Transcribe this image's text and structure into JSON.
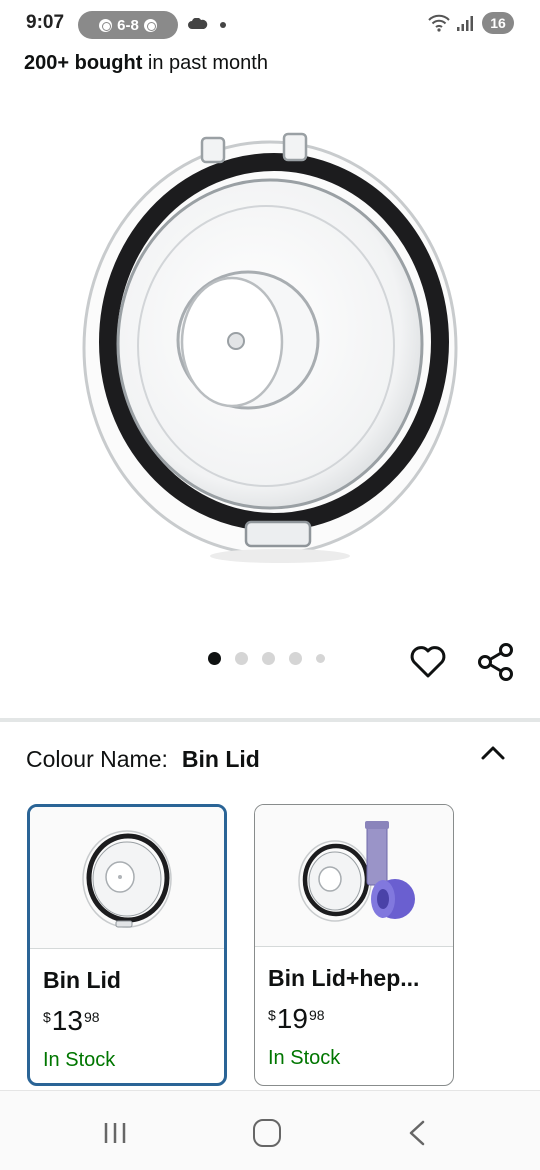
{
  "status_bar": {
    "time": "9:07",
    "score": "6-8",
    "battery": "16",
    "icons": [
      "cloud-icon",
      "wifi-icon",
      "signal-icon",
      "battery-icon"
    ]
  },
  "bought": {
    "count": "200+ bought",
    "suffix": " in past month"
  },
  "carousel": {
    "total_images": 5,
    "active_index": 0
  },
  "colour": {
    "label": "Colour Name:",
    "value": "Bin Lid"
  },
  "swatches": [
    {
      "title": "Bin Lid",
      "currency": "$",
      "whole": "13",
      "fraction": "98",
      "stock": "In Stock",
      "selected": true
    },
    {
      "title": "Bin Lid+hep...",
      "currency": "$",
      "whole": "19",
      "fraction": "98",
      "stock": "In Stock",
      "selected": false
    }
  ],
  "colors": {
    "selected_border": "#2a6496",
    "in_stock": "#007600",
    "text": "#0f1111"
  }
}
